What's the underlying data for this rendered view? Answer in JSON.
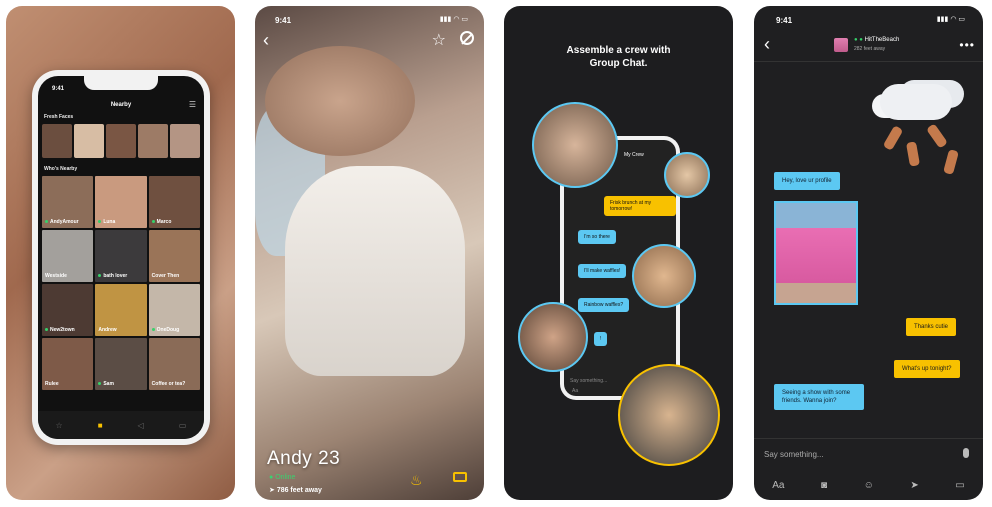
{
  "screens": [
    {
      "id": "nearby-grid",
      "status_time": "9:41",
      "nav_title": "Nearby",
      "section_fresh": "Fresh Faces",
      "section_nearby": "Who's Nearby",
      "profiles": [
        "AndyAmour",
        "Luna",
        "Marco",
        "Westside",
        "bath lover",
        "Cover Then",
        "New2town",
        "Andrew",
        "OneDoug",
        "Rulee",
        "Sam",
        "Coffee or tea?"
      ],
      "tabbar_icons": [
        "star-icon",
        "mask-icon",
        "chat-tab-icon",
        "message-icon"
      ],
      "accent": "#f8c100"
    },
    {
      "id": "profile",
      "status_time": "9:41",
      "name": "Andy",
      "age": "23",
      "online": "Online",
      "distance": "786 feet away",
      "accent": "#f8c100",
      "online_color": "#3bd16f"
    },
    {
      "id": "group-chat",
      "headline_line1": "Assemble a crew with",
      "headline_line2": "Group Chat.",
      "crew_title": "My Crew",
      "messages": [
        "Frisk brunch at my tomorrow!",
        "I'm so there",
        "I'll make waffles!",
        "Rainbow waffles?",
        "!"
      ],
      "compose_placeholder": "Say something...",
      "compose_label": "Aa",
      "bubble_yellow": "#f8c100",
      "bubble_blue": "#5cc8f2"
    },
    {
      "id": "chat",
      "status_time": "9:41",
      "username": "HitTheBeach",
      "distance": "282 feet away",
      "messages": [
        {
          "dir": "in",
          "text": "Hey, love ur profile"
        },
        {
          "dir": "out",
          "text": "Thanks cutie"
        },
        {
          "dir": "out",
          "text": "What's up tonight?"
        },
        {
          "dir": "in",
          "text": "Seeing a show with some friends. Wanna join?"
        }
      ],
      "input_placeholder": "Say something...",
      "toolbar_label": "Aa",
      "toolbar_icons": [
        "camera-icon",
        "sticker-icon",
        "location-icon",
        "saved-phrases-icon"
      ]
    }
  ]
}
